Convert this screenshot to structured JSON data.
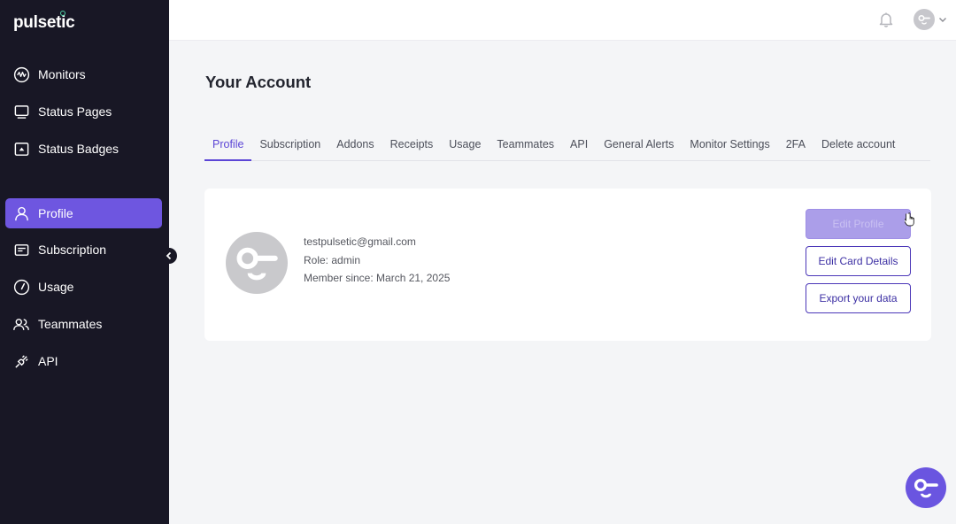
{
  "app": {
    "logo": "pulsetic"
  },
  "sidebar": {
    "items": [
      {
        "label": "Monitors",
        "icon": "monitor-wave-icon"
      },
      {
        "label": "Status Pages",
        "icon": "screen-icon"
      },
      {
        "label": "Status Badges",
        "icon": "badge-icon"
      },
      {
        "label": "Profile",
        "icon": "user-icon",
        "active": true
      },
      {
        "label": "Subscription",
        "icon": "card-icon"
      },
      {
        "label": "Usage",
        "icon": "gauge-icon"
      },
      {
        "label": "Teammates",
        "icon": "users-icon"
      },
      {
        "label": "API",
        "icon": "plug-icon"
      }
    ]
  },
  "header": {
    "icons": [
      "bell-icon",
      "avatar-icon",
      "chevron-down-icon"
    ]
  },
  "main": {
    "title": "Your Account",
    "tabs": [
      {
        "label": "Profile",
        "active": true
      },
      {
        "label": "Subscription"
      },
      {
        "label": "Addons"
      },
      {
        "label": "Receipts"
      },
      {
        "label": "Usage"
      },
      {
        "label": "Teammates"
      },
      {
        "label": "API"
      },
      {
        "label": "General Alerts"
      },
      {
        "label": "Monitor Settings"
      },
      {
        "label": "2FA"
      },
      {
        "label": "Delete account"
      }
    ],
    "profile": {
      "email": "testpulsetic@gmail.com",
      "role": "Role: admin",
      "member_since": "Member since: March 21, 2025"
    },
    "buttons": {
      "edit_profile": "Edit Profile",
      "edit_card": "Edit Card Details",
      "export": "Export your data"
    }
  },
  "colors": {
    "sidebar_bg": "#181725",
    "accent": "#6e56e0",
    "page_bg": "#f4f5f7"
  }
}
